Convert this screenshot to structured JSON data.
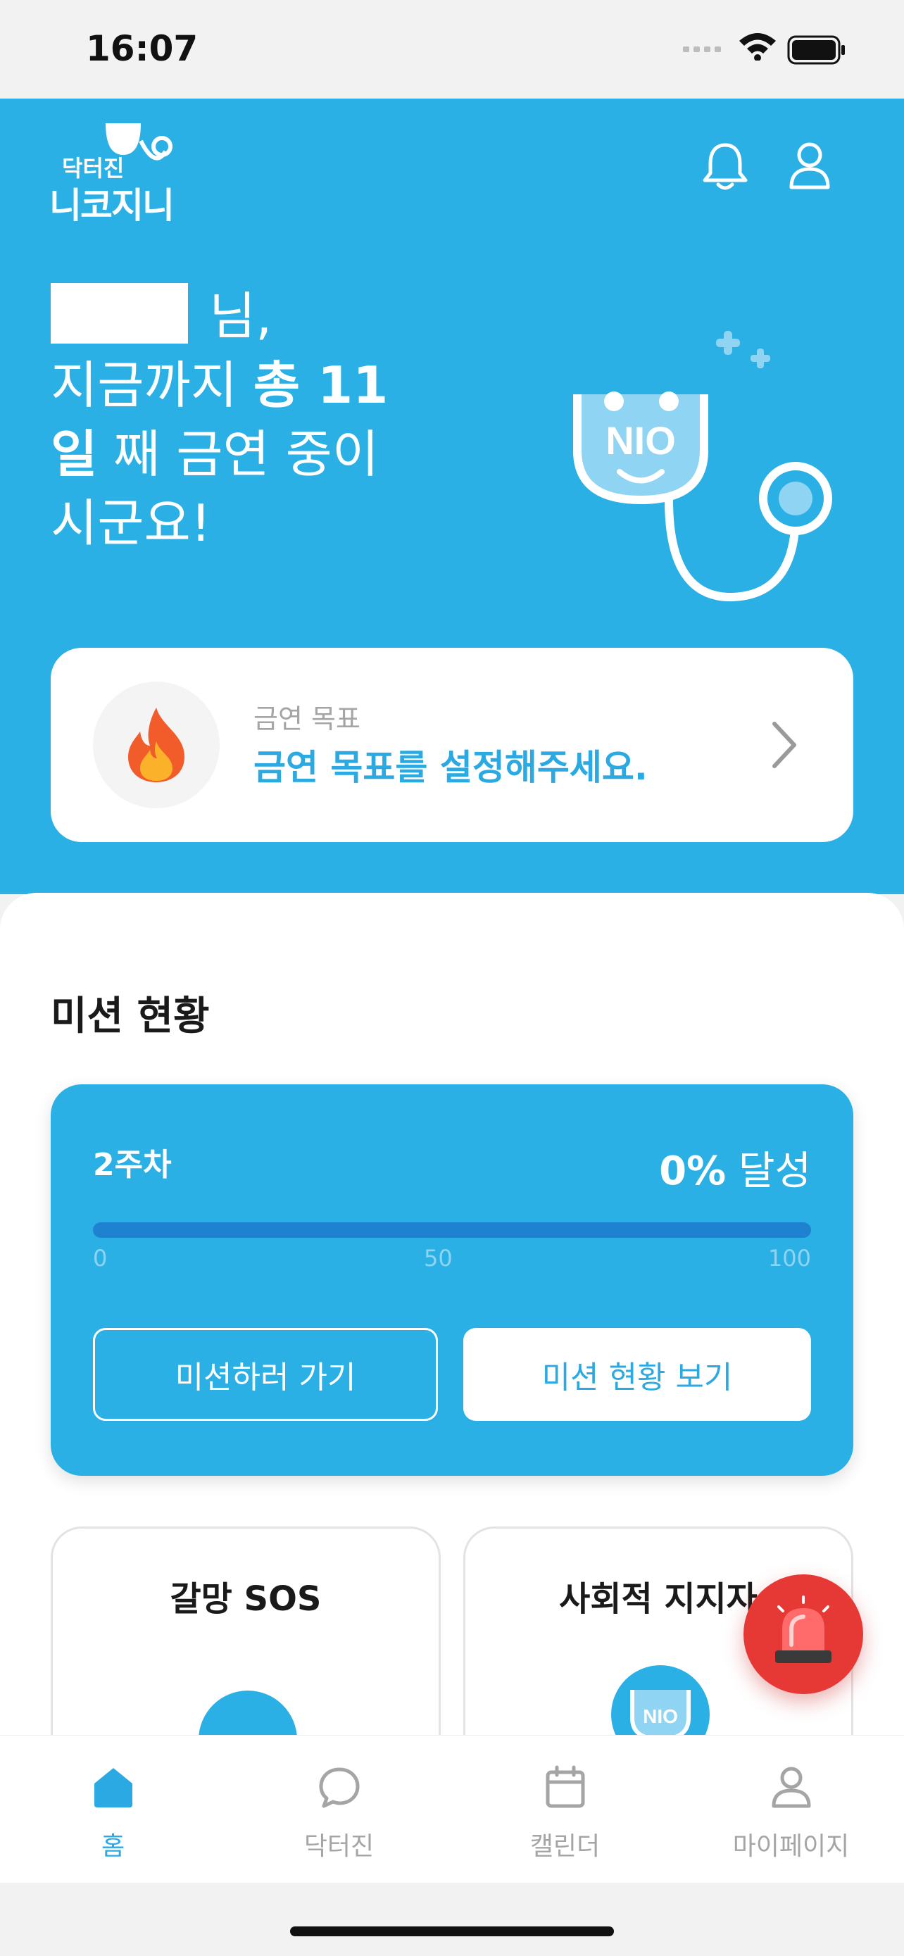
{
  "status_bar": {
    "time": "16:07"
  },
  "header": {
    "logo_line1": "닥터진",
    "logo_line2": "니코지니"
  },
  "greeting": {
    "suffix": "님,",
    "line2_prefix": "지금까지 ",
    "line2_bold": "총 11",
    "line3_bold": "일",
    "line3_rest": " 째 금연 중이",
    "line4": "시군요!"
  },
  "goal_card": {
    "label": "금연 목표",
    "text": "금연 목표를 설정해주세요."
  },
  "mission": {
    "section_title": "미션 현황",
    "week": "2주차",
    "percent_value": "0%",
    "percent_label": "달성",
    "progress": 0,
    "ticks": [
      "0",
      "50",
      "100"
    ],
    "button_go": "미션하러 가기",
    "button_view": "미션 현황 보기"
  },
  "tiles": {
    "craving_title": "갈망 SOS",
    "support_title": "사회적 지지자"
  },
  "tabbar": {
    "items": [
      {
        "label": "홈",
        "icon": "home-icon",
        "active": true
      },
      {
        "label": "닥터진",
        "icon": "chat-bubble-icon",
        "active": false
      },
      {
        "label": "캘린더",
        "icon": "calendar-icon",
        "active": false
      },
      {
        "label": "마이페이지",
        "icon": "person-icon",
        "active": false
      }
    ]
  },
  "colors": {
    "brand_blue": "#2bb0e6",
    "accent_text_blue": "#2ba9e3",
    "progress_track": "#1f82d1",
    "sos_red": "#e63935"
  }
}
